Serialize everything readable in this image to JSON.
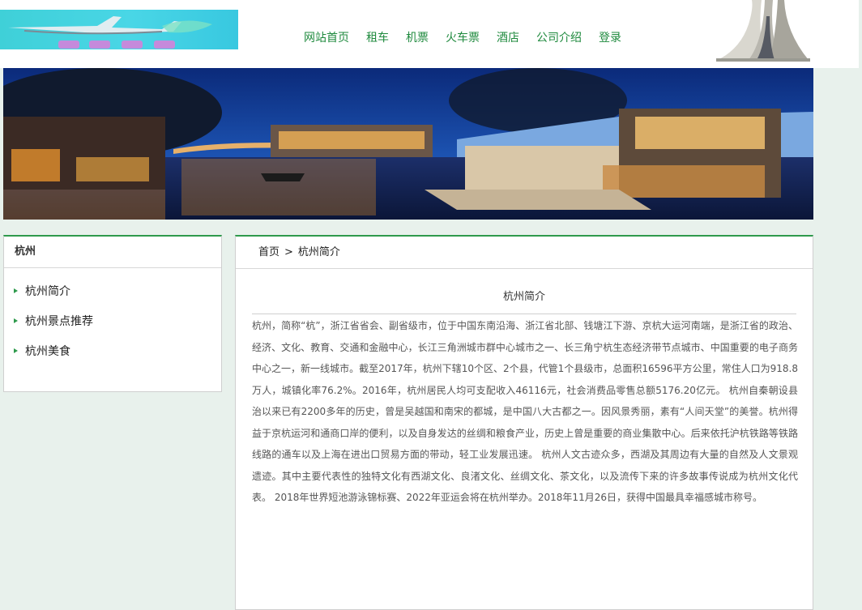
{
  "nav": {
    "items": [
      "网站首页",
      "租车",
      "机票",
      "火车票",
      "酒店",
      "公司介绍",
      "登录"
    ]
  },
  "sidebar": {
    "title": "杭州",
    "items": [
      "杭州简介",
      "杭州景点推荐",
      "杭州美食"
    ]
  },
  "breadcrumb": {
    "home": "首页",
    "separator": ">",
    "current": "杭州简介"
  },
  "article": {
    "title": "杭州简介",
    "body": "杭州，简称“杭”，浙江省省会、副省级市，位于中国东南沿海、浙江省北部、钱塘江下游、京杭大运河南端，是浙江省的政治、经济、文化、教育、交通和金融中心，长江三角洲城市群中心城市之一、长三角宁杭生态经济带节点城市、中国重要的电子商务中心之一，新一线城市。截至2017年，杭州下辖10个区、2个县，代管1个县级市，总面积16596平方公里，常住人口为918.8万人，城镇化率76.2%。2016年，杭州居民人均可支配收入46116元，社会消费品零售总额5176.20亿元。 杭州自秦朝设县治以来已有2200多年的历史，曾是吴越国和南宋的都城，是中国八大古都之一。因风景秀丽，素有“人间天堂”的美誉。杭州得益于京杭运河和通商口岸的便利，以及自身发达的丝绸和粮食产业，历史上曾是重要的商业集散中心。后来依托沪杭铁路等铁路线路的通车以及上海在进出口贸易方面的带动，轻工业发展迅速。 杭州人文古迹众多，西湖及其周边有大量的自然及人文景观遗迹。其中主要代表性的独特文化有西湖文化、良渚文化、丝绸文化、茶文化，以及流传下来的许多故事传说成为杭州文化代表。 2018年世界短池游泳锦标赛、2022年亚运会将在杭州举办。2018年11月26日，获得中国最具幸福感城市称号。"
  },
  "colors": {
    "accent": "#2e9a4c",
    "nav_text": "#1f8a3e",
    "page_bg": "#e8f1ec"
  },
  "icons": {
    "logo": "airplane-logo",
    "list_marker": "triangle-right-icon"
  }
}
